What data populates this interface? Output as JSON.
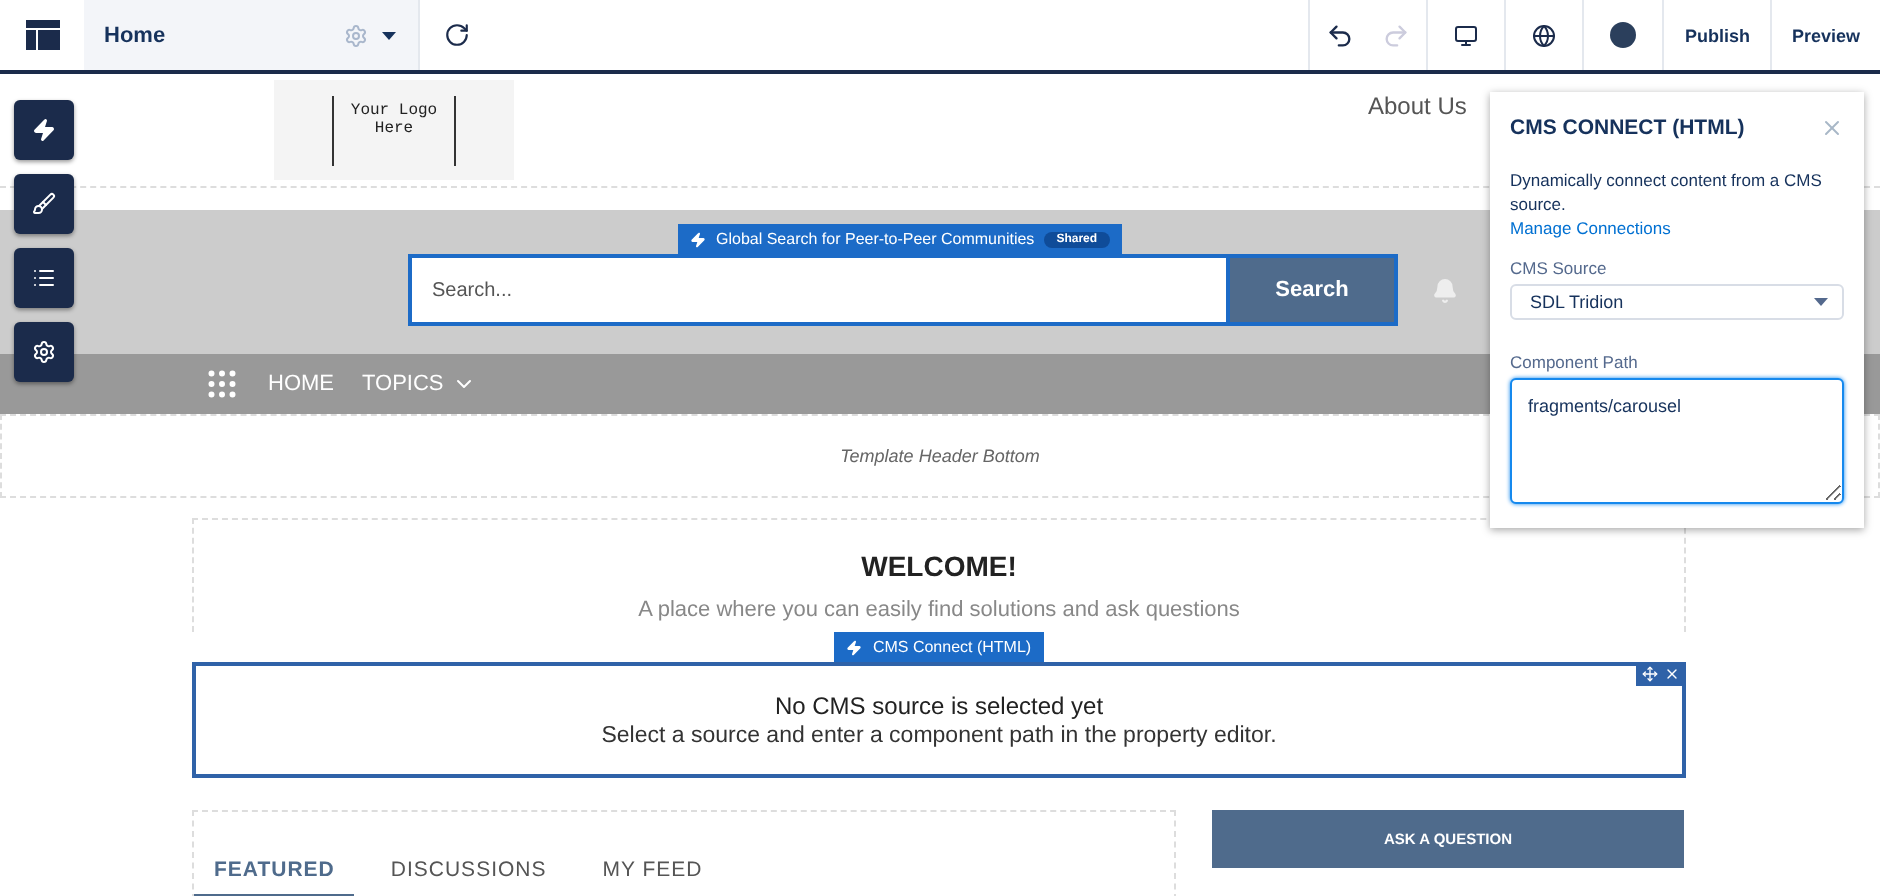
{
  "toolbar": {
    "page_tab": "Home",
    "buttons": [
      {
        "label": "Publish"
      },
      {
        "label": "Preview"
      }
    ]
  },
  "logo": {
    "lines": [
      "Your Logo",
      "Here"
    ]
  },
  "nav_links": [
    "About Us"
  ],
  "search_component": {
    "label": "Global Search for Peer-to-Peer Communities",
    "badge": "Shared",
    "placeholder": "Search...",
    "button": "Search"
  },
  "menu": [
    {
      "label": "HOME",
      "kind": "link"
    },
    {
      "label": "TOPICS",
      "kind": "dropdown"
    }
  ],
  "template_region": "Template Header Bottom",
  "welcome": {
    "title": "WELCOME!",
    "subtitle": "A place where you can easily find solutions and ask questions"
  },
  "cms_component": {
    "label": "CMS Connect (HTML)",
    "message": "No CMS source is selected yet",
    "hint": "Select a source and enter a component path in the property editor."
  },
  "feed_tabs": [
    {
      "label": "FEATURED",
      "selected": true
    },
    {
      "label": "DISCUSSIONS",
      "selected": false
    },
    {
      "label": "MY FEED",
      "selected": false
    }
  ],
  "ask_button": "ASK A QUESTION",
  "property_panel": {
    "title": "CMS CONNECT (HTML)",
    "description": "Dynamically connect content from a CMS source.",
    "link": "Manage Connections",
    "fields": [
      {
        "kind": "select",
        "label": "CMS Source",
        "value": "SDL Tridion"
      },
      {
        "kind": "textarea",
        "label": "Component Path",
        "value": "fragments/carousel"
      }
    ]
  }
}
